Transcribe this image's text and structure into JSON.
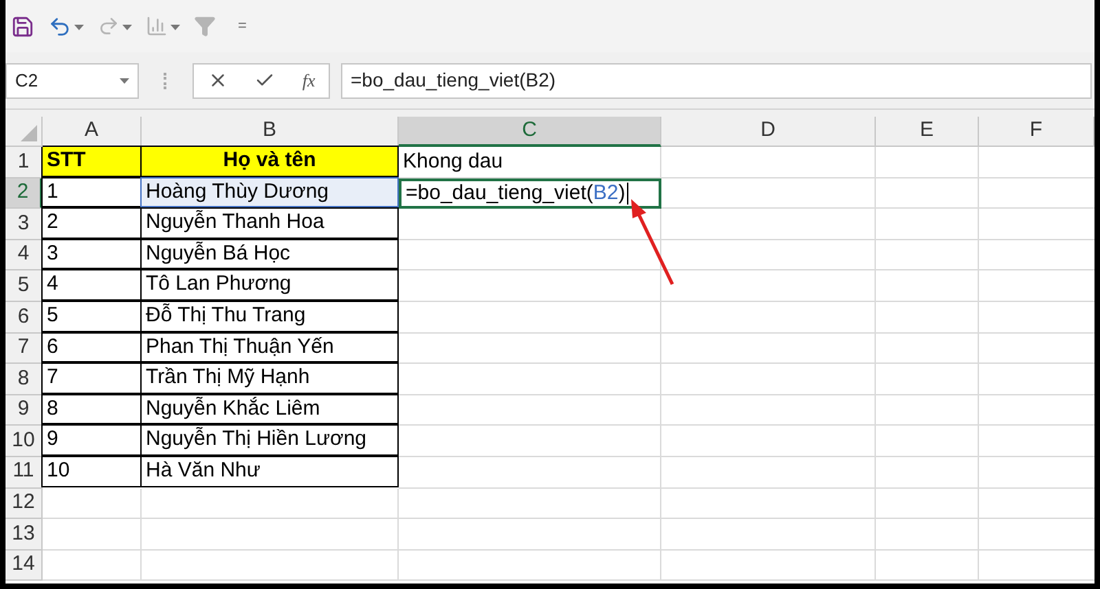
{
  "toolbar": {
    "customize_glyph": "="
  },
  "formula_bar": {
    "name_box": "C2",
    "fx_label": "fx",
    "formula": "=bo_dau_tieng_viet(B2)"
  },
  "columns": [
    {
      "label": "A",
      "selected": false
    },
    {
      "label": "B",
      "selected": false
    },
    {
      "label": "C",
      "selected": true
    },
    {
      "label": "D",
      "selected": false
    },
    {
      "label": "E",
      "selected": false
    },
    {
      "label": "F",
      "selected": false
    }
  ],
  "rows": [
    {
      "header": "1",
      "selected": false,
      "kind": "title",
      "a": "STT",
      "b": "Họ và tên",
      "c": [
        {
          "text": "Khong dau",
          "kind": "plain"
        }
      ]
    },
    {
      "header": "2",
      "selected": true,
      "kind": "data",
      "a": "1",
      "b": "Hoàng Thùy Dương",
      "c": [
        {
          "text": "=bo_dau_tieng_viet(",
          "kind": "plain"
        },
        {
          "text": "B2",
          "kind": "ref"
        },
        {
          "text": ")",
          "kind": "plain"
        }
      ]
    },
    {
      "header": "3",
      "selected": false,
      "kind": "data",
      "a": "2",
      "b": "Nguyễn Thanh Hoa"
    },
    {
      "header": "4",
      "selected": false,
      "kind": "data",
      "a": "3",
      "b": "Nguyễn Bá Học"
    },
    {
      "header": "5",
      "selected": false,
      "kind": "data",
      "a": "4",
      "b": "Tô Lan Phương"
    },
    {
      "header": "6",
      "selected": false,
      "kind": "data",
      "a": "5",
      "b": "Đỗ Thị Thu Trang"
    },
    {
      "header": "7",
      "selected": false,
      "kind": "data",
      "a": "6",
      "b": "Phan Thị Thuận Yến"
    },
    {
      "header": "8",
      "selected": false,
      "kind": "data",
      "a": "7",
      "b": "Trần Thị Mỹ Hạnh"
    },
    {
      "header": "9",
      "selected": false,
      "kind": "data",
      "a": "8",
      "b": "Nguyễn Khắc Liêm"
    },
    {
      "header": "10",
      "selected": false,
      "kind": "data",
      "a": "9",
      "b": "Nguyễn Thị Hiền Lương"
    },
    {
      "header": "11",
      "selected": false,
      "kind": "data",
      "a": "10",
      "b": "Hà Văn Như"
    },
    {
      "header": "12",
      "selected": false,
      "kind": "empty"
    },
    {
      "header": "13",
      "selected": false,
      "kind": "empty"
    },
    {
      "header": "14",
      "selected": false,
      "kind": "empty"
    }
  ]
}
